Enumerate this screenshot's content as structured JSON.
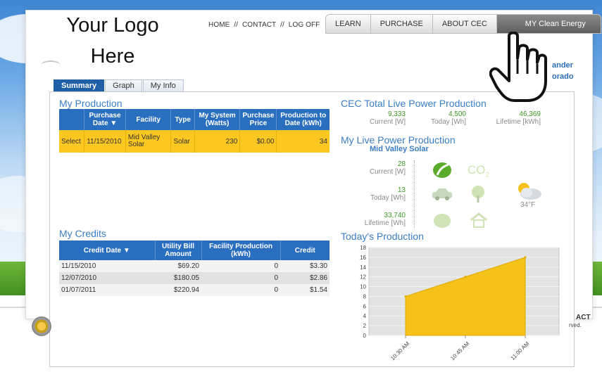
{
  "header": {
    "logo_line1": "Your Logo",
    "logo_line2": "Here",
    "top_links": [
      "HOME",
      "//",
      "CONTACT",
      "//",
      "LOG OFF"
    ],
    "main_tabs": [
      "LEARN",
      "PURCHASE",
      "ABOUT CEC",
      "MY Clean Energy"
    ],
    "user_line1": "ander",
    "user_line2": "orado"
  },
  "subtabs": [
    "Summary",
    "Graph",
    "My Info"
  ],
  "my_production": {
    "title": "My Production",
    "columns": [
      "",
      "Purchase Date ▼",
      "Facility",
      "Type",
      "My System (Watts)",
      "Purchase Price",
      "Production to Date (kWh)"
    ],
    "rows": [
      [
        "Select",
        "11/15/2010",
        "Mid Valley Solar",
        "Solar",
        "230",
        "$0.00",
        "34"
      ]
    ]
  },
  "my_credits": {
    "title": "My Credits",
    "columns": [
      "Credit Date ▼",
      "Utility Bill Amount",
      "Facility Production (kWh)",
      "Credit"
    ],
    "rows": [
      [
        "11/15/2010",
        "$69.20",
        "0",
        "$3.30"
      ],
      [
        "12/07/2010",
        "$180.05",
        "0",
        "$2.86"
      ],
      [
        "01/07/2011",
        "$220.94",
        "0",
        "$1.54"
      ]
    ]
  },
  "cec_total": {
    "title": "CEC Total Live Power Production",
    "stats": [
      {
        "value": "9,333",
        "label": "Current [W]"
      },
      {
        "value": "4,500",
        "label": "Today [Wh]"
      },
      {
        "value": "46,369",
        "label": "Lifetime [kWh]"
      }
    ]
  },
  "live_power": {
    "title": "My Live Power Production",
    "facility": "Mid Valley Solar",
    "stats": [
      {
        "value": "28",
        "label": "Current [W]"
      },
      {
        "value": "13",
        "label": "Today [Wh]"
      },
      {
        "value": "33,740",
        "label": "Lifetime [Wh]"
      }
    ],
    "co2_label": "CO",
    "co2_sub": "2",
    "temperature": "34°F",
    "icons": [
      "leaf-icon",
      "co2-icon",
      "car-icon",
      "tree-icon",
      "weather-icon",
      "light-bulb-icon",
      "house-icon"
    ]
  },
  "todays_production": {
    "title": "Today's Production"
  },
  "chart_data": {
    "type": "area",
    "title": "Today's Production",
    "x": [
      "10:30 AM",
      "10:45 AM",
      "11:00 AM"
    ],
    "series": [
      {
        "values": [
          8,
          12,
          16
        ]
      }
    ],
    "ylim": [
      0,
      18
    ],
    "yticks": [
      0,
      2,
      4,
      6,
      8,
      10,
      12,
      14,
      16,
      18
    ],
    "grid": true,
    "color": "#f4c21b"
  },
  "footer": {
    "contact_partial": "ACT",
    "reserved_partial": "rved."
  },
  "colors": {
    "accent": "#2a6fbf",
    "highlight": "#fbc720",
    "heading": "#3a7dc4",
    "value_green": "#3a9a22"
  }
}
